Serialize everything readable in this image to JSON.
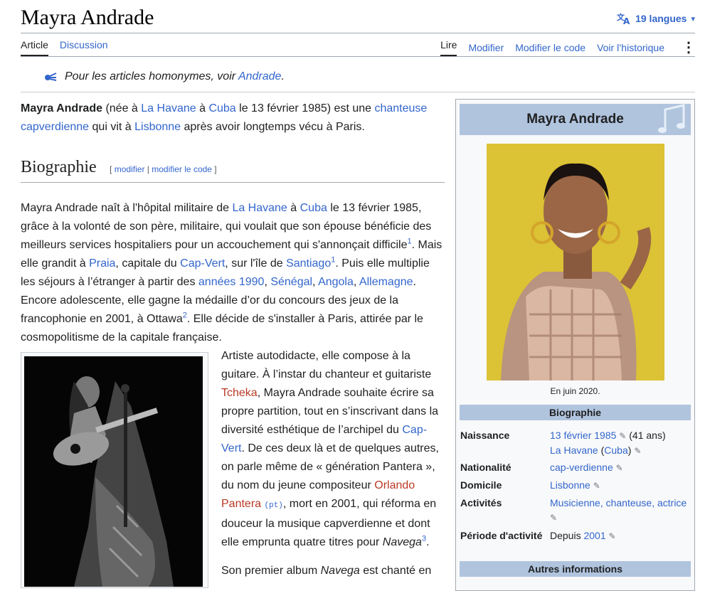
{
  "header": {
    "title": "Mayra Andrade",
    "languages_label": "19 langues"
  },
  "tabs": {
    "article": "Article",
    "discussion": "Discussion",
    "read": "Lire",
    "edit": "Modifier",
    "edit_source": "Modifier le code",
    "history": "Voir l’historique"
  },
  "hatnote": {
    "prefix": "Pour les articles homonymes, voir ",
    "link": "Andrade",
    "suffix": "."
  },
  "lead": {
    "name": "Mayra Andrade",
    "t1": " (née à ",
    "l1": "La Havane",
    "t2": " à ",
    "l2": "Cuba",
    "t3": " le 13 février 1985) est une ",
    "l3": "chanteuse capverdienne",
    "t4": " qui vit à ",
    "l4": "Lisbonne",
    "t5": " après avoir longtemps vécu à Paris."
  },
  "section": {
    "title": "Biographie",
    "edit_open": "[ ",
    "edit": "modifier",
    "sep": " | ",
    "edit_source": "modifier le code",
    "edit_close": " ]"
  },
  "bio": {
    "t1": "Mayra Andrade naît à l'hôpital militaire de ",
    "l1": "La Havane",
    "t2": " à ",
    "l2": "Cuba",
    "t3": " le 13 février 1985, grâce à la volonté de son père, militaire, qui voulait que son épouse bénéficie des meilleurs services hospitaliers pour un accouchement qui s'annonçait difficile",
    "r1": "1",
    "t4": ". Mais elle grandit à ",
    "l3": "Praia",
    "t5": ", capitale du ",
    "l4": "Cap-Vert",
    "t6": ", sur l'île de ",
    "l5": "Santiago",
    "r2": "1",
    "t7": ". Puis elle multiplie les séjours à l’étranger à partir des ",
    "l6": "années 1990",
    "t8": ", ",
    "l7": "Sénégal",
    "t9": ", ",
    "l8": "Angola",
    "t10": ", ",
    "l9": "Allemagne",
    "t11": ". Encore adolescente, elle gagne la médaille d’or du concours des jeux de la francophonie en 2001, à ",
    "l10": "Ottawa",
    "r3": "2",
    "t12": ". Elle décide de s'installer à Paris, attirée par le cosmopolitisme de la capitale française."
  },
  "side": {
    "t1": "Artiste autodidacte, elle compose à la guitare. À l’instar du chanteur et guitariste ",
    "l1": "Tcheka",
    "t2": ", Mayra Andrade souhaite écrire sa propre partition, tout en s’inscrivant dans la diversité esthétique de l’archipel du ",
    "l2": "Cap-Vert",
    "t3": ". De ces deux là et de quelques autres, on parle même de « génération Pantera », du nom du jeune compositeur ",
    "l3": "Orlando Pantera",
    "pt": "(pt)",
    "t4": ", mort en 2001, qui réforma en douceur la musique capverdienne et dont elle emprunta quatre titres pour ",
    "album": "Navega",
    "r1": "3",
    "t5": ".",
    "p2a": "Son premier album ",
    "p2b": "Navega",
    "p2c": " est chanté en"
  },
  "infobox": {
    "title": "Mayra Andrade",
    "caption": "En juin 2020.",
    "section1": "Biographie",
    "section2": "Autres informations",
    "rows": {
      "birth_label": "Naissance",
      "birth_date": "13 février 1985",
      "birth_age": " (41 ans)",
      "birth_place": "La Havane",
      "birth_country": "Cuba",
      "nat_label": "Nationalité",
      "nat_value": "cap-verdienne",
      "home_label": "Domicile",
      "home_value": "Lisbonne",
      "act_label": "Activités",
      "act_value": "Musicienne, chanteuse, actrice",
      "period_label": "Période d'activité",
      "period_prefix": "Depuis ",
      "period_year": "2001"
    }
  },
  "colors": {
    "link": "#3366cc",
    "redlink": "#ba3925",
    "infobox_header": "#b0c4de"
  },
  "icons": [
    "translate-icon",
    "chevron-down-icon",
    "kebab-menu-icon",
    "disambiguation-icon",
    "music-note-icon",
    "pencil-icon"
  ]
}
